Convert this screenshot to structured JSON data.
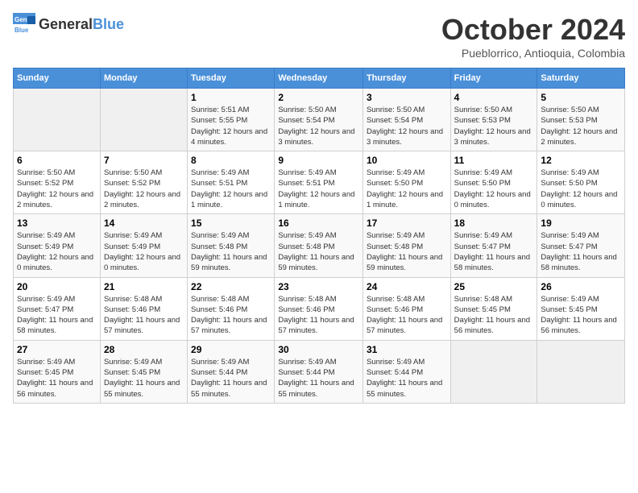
{
  "logo": {
    "general": "General",
    "blue": "Blue"
  },
  "title": {
    "month": "October 2024",
    "location": "Pueblorrico, Antioquia, Colombia"
  },
  "weekdays": [
    "Sunday",
    "Monday",
    "Tuesday",
    "Wednesday",
    "Thursday",
    "Friday",
    "Saturday"
  ],
  "weeks": [
    [
      {
        "day": "",
        "info": ""
      },
      {
        "day": "",
        "info": ""
      },
      {
        "day": "1",
        "info": "Sunrise: 5:51 AM\nSunset: 5:55 PM\nDaylight: 12 hours and 4 minutes."
      },
      {
        "day": "2",
        "info": "Sunrise: 5:50 AM\nSunset: 5:54 PM\nDaylight: 12 hours and 3 minutes."
      },
      {
        "day": "3",
        "info": "Sunrise: 5:50 AM\nSunset: 5:54 PM\nDaylight: 12 hours and 3 minutes."
      },
      {
        "day": "4",
        "info": "Sunrise: 5:50 AM\nSunset: 5:53 PM\nDaylight: 12 hours and 3 minutes."
      },
      {
        "day": "5",
        "info": "Sunrise: 5:50 AM\nSunset: 5:53 PM\nDaylight: 12 hours and 2 minutes."
      }
    ],
    [
      {
        "day": "6",
        "info": "Sunrise: 5:50 AM\nSunset: 5:52 PM\nDaylight: 12 hours and 2 minutes."
      },
      {
        "day": "7",
        "info": "Sunrise: 5:50 AM\nSunset: 5:52 PM\nDaylight: 12 hours and 2 minutes."
      },
      {
        "day": "8",
        "info": "Sunrise: 5:49 AM\nSunset: 5:51 PM\nDaylight: 12 hours and 1 minute."
      },
      {
        "day": "9",
        "info": "Sunrise: 5:49 AM\nSunset: 5:51 PM\nDaylight: 12 hours and 1 minute."
      },
      {
        "day": "10",
        "info": "Sunrise: 5:49 AM\nSunset: 5:50 PM\nDaylight: 12 hours and 1 minute."
      },
      {
        "day": "11",
        "info": "Sunrise: 5:49 AM\nSunset: 5:50 PM\nDaylight: 12 hours and 0 minutes."
      },
      {
        "day": "12",
        "info": "Sunrise: 5:49 AM\nSunset: 5:50 PM\nDaylight: 12 hours and 0 minutes."
      }
    ],
    [
      {
        "day": "13",
        "info": "Sunrise: 5:49 AM\nSunset: 5:49 PM\nDaylight: 12 hours and 0 minutes."
      },
      {
        "day": "14",
        "info": "Sunrise: 5:49 AM\nSunset: 5:49 PM\nDaylight: 12 hours and 0 minutes."
      },
      {
        "day": "15",
        "info": "Sunrise: 5:49 AM\nSunset: 5:48 PM\nDaylight: 11 hours and 59 minutes."
      },
      {
        "day": "16",
        "info": "Sunrise: 5:49 AM\nSunset: 5:48 PM\nDaylight: 11 hours and 59 minutes."
      },
      {
        "day": "17",
        "info": "Sunrise: 5:49 AM\nSunset: 5:48 PM\nDaylight: 11 hours and 59 minutes."
      },
      {
        "day": "18",
        "info": "Sunrise: 5:49 AM\nSunset: 5:47 PM\nDaylight: 11 hours and 58 minutes."
      },
      {
        "day": "19",
        "info": "Sunrise: 5:49 AM\nSunset: 5:47 PM\nDaylight: 11 hours and 58 minutes."
      }
    ],
    [
      {
        "day": "20",
        "info": "Sunrise: 5:49 AM\nSunset: 5:47 PM\nDaylight: 11 hours and 58 minutes."
      },
      {
        "day": "21",
        "info": "Sunrise: 5:48 AM\nSunset: 5:46 PM\nDaylight: 11 hours and 57 minutes."
      },
      {
        "day": "22",
        "info": "Sunrise: 5:48 AM\nSunset: 5:46 PM\nDaylight: 11 hours and 57 minutes."
      },
      {
        "day": "23",
        "info": "Sunrise: 5:48 AM\nSunset: 5:46 PM\nDaylight: 11 hours and 57 minutes."
      },
      {
        "day": "24",
        "info": "Sunrise: 5:48 AM\nSunset: 5:46 PM\nDaylight: 11 hours and 57 minutes."
      },
      {
        "day": "25",
        "info": "Sunrise: 5:48 AM\nSunset: 5:45 PM\nDaylight: 11 hours and 56 minutes."
      },
      {
        "day": "26",
        "info": "Sunrise: 5:49 AM\nSunset: 5:45 PM\nDaylight: 11 hours and 56 minutes."
      }
    ],
    [
      {
        "day": "27",
        "info": "Sunrise: 5:49 AM\nSunset: 5:45 PM\nDaylight: 11 hours and 56 minutes."
      },
      {
        "day": "28",
        "info": "Sunrise: 5:49 AM\nSunset: 5:45 PM\nDaylight: 11 hours and 55 minutes."
      },
      {
        "day": "29",
        "info": "Sunrise: 5:49 AM\nSunset: 5:44 PM\nDaylight: 11 hours and 55 minutes."
      },
      {
        "day": "30",
        "info": "Sunrise: 5:49 AM\nSunset: 5:44 PM\nDaylight: 11 hours and 55 minutes."
      },
      {
        "day": "31",
        "info": "Sunrise: 5:49 AM\nSunset: 5:44 PM\nDaylight: 11 hours and 55 minutes."
      },
      {
        "day": "",
        "info": ""
      },
      {
        "day": "",
        "info": ""
      }
    ]
  ]
}
